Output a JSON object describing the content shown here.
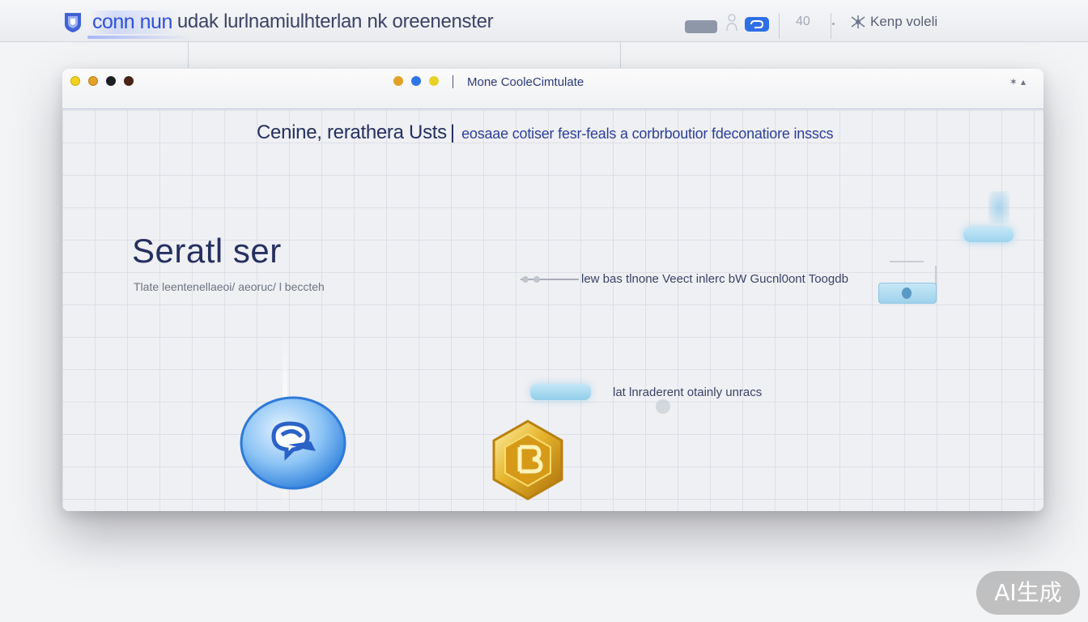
{
  "browser": {
    "brand": "conn nun",
    "title": "udak lurlnamiulhterlan nk oreenenster",
    "zoom": "40",
    "account": "Kenp voleli"
  },
  "window": {
    "title": "Mone CooleCimtulate"
  },
  "headline": {
    "main": "Cenine, rerathera Usts",
    "separator": "|",
    "tagline": "eosaae cotiser fesr-feals a corbrboutior fdeconatiore insscs"
  },
  "hero": {
    "title": "Seratl ser",
    "subtitle": "Tlate leentenellaeoi/ aeoruc/ l beccteh"
  },
  "link_row": {
    "text": "lew bas tlnone Veect inlerc bW Gucnl0ont Toogdb"
  },
  "action_row": {
    "text": "lat lnraderent otainly unracs"
  },
  "watermark": {
    "text": "AI生成"
  },
  "colors": {
    "accent_blue": "#2f6fe4",
    "brand_blue": "#2f4fd8",
    "heading_navy": "#243060",
    "pill_light_blue": "#9dd3ee",
    "gold": "#d8a51f"
  }
}
